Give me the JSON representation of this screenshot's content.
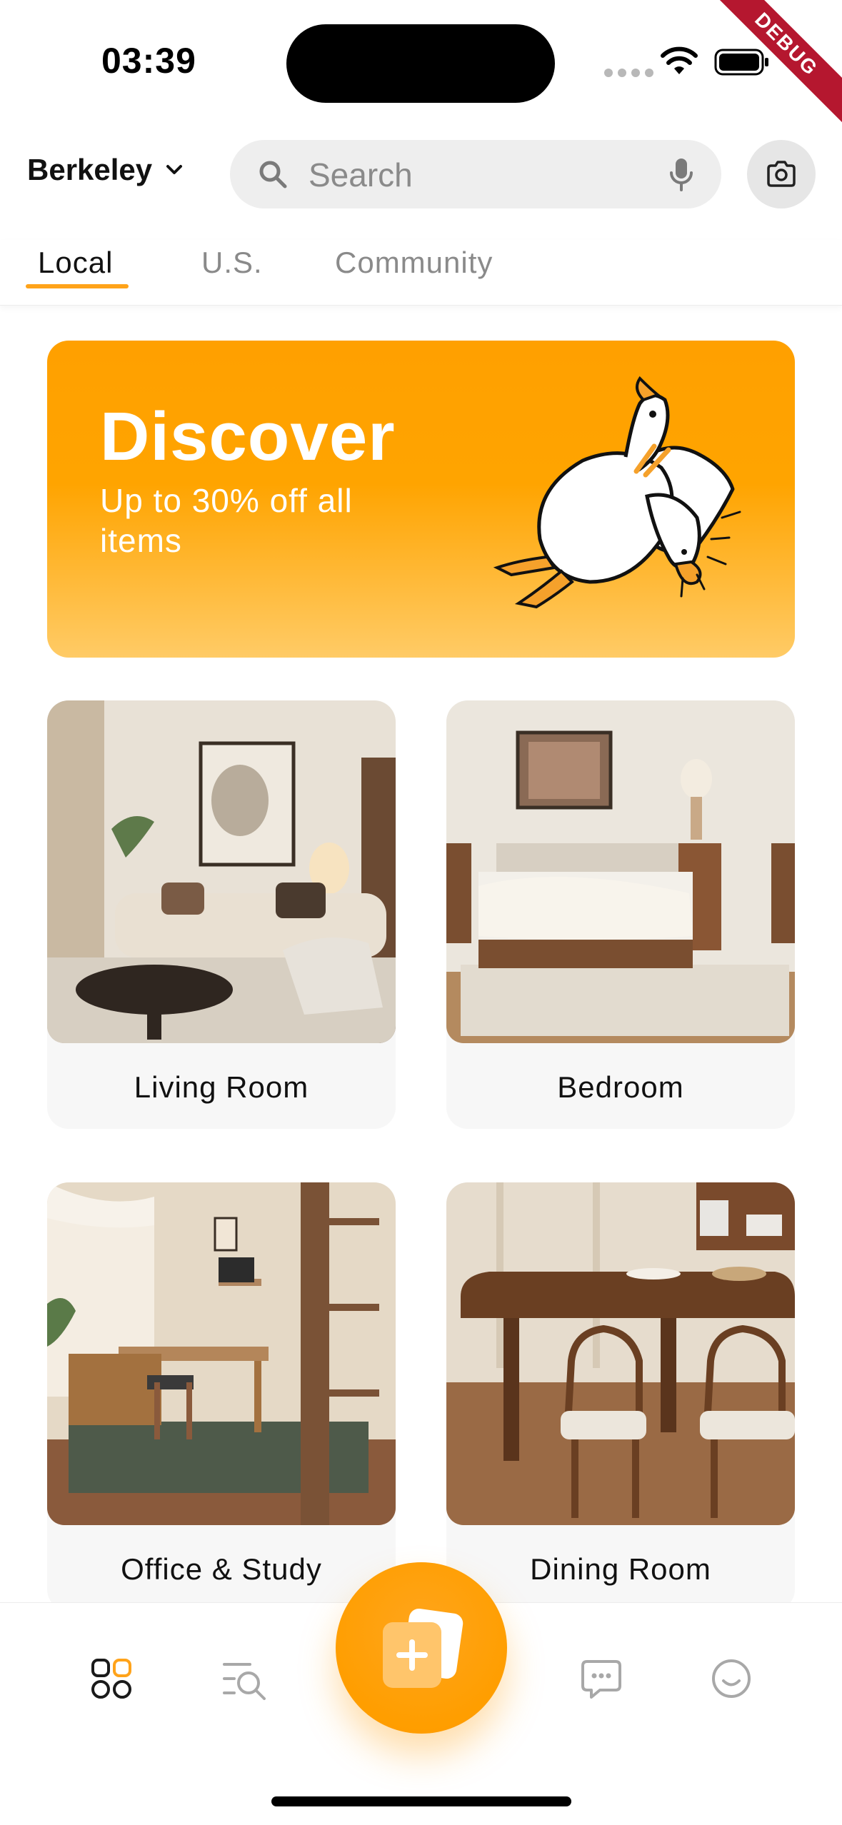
{
  "status_bar": {
    "time": "03:39",
    "debug_label": "DEBUG"
  },
  "header": {
    "location": "Berkeley",
    "search_placeholder": "Search"
  },
  "tabs": [
    {
      "label": "Local",
      "active": true
    },
    {
      "label": "U.S.",
      "active": false
    },
    {
      "label": "Community",
      "active": false
    }
  ],
  "banner": {
    "title": "Discover",
    "subtitle": "Up to 30% off all items"
  },
  "categories": [
    {
      "label": "Living Room"
    },
    {
      "label": "Bedroom"
    },
    {
      "label": "Office & Study"
    },
    {
      "label": "Dining Room"
    }
  ],
  "bottom_nav": {
    "items": [
      "home-grid-icon",
      "search-list-icon",
      "add-post-icon",
      "chat-icon",
      "profile-smile-icon"
    ],
    "active_color": "#ffa31a",
    "inactive_color": "#a8a8a8"
  },
  "colors": {
    "accent": "#ffa31a",
    "banner_top": "#ffa000",
    "banner_bottom": "#ffcb66"
  }
}
